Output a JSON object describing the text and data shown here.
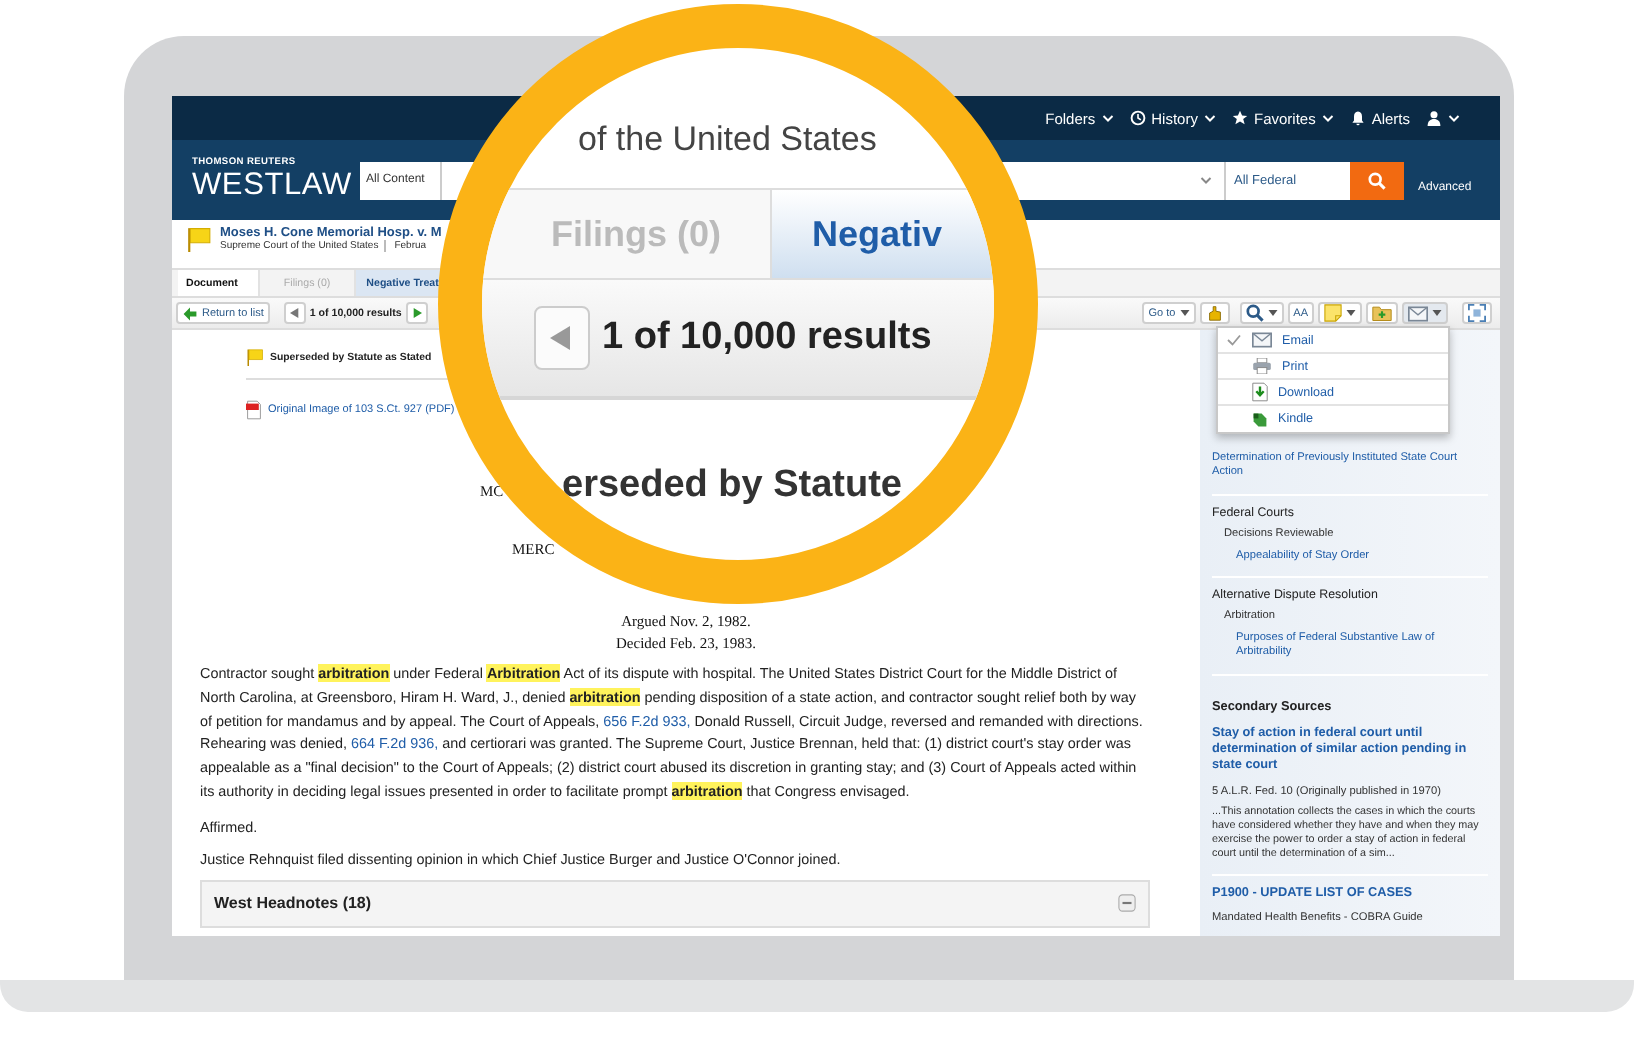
{
  "top_nav": {
    "items": [
      {
        "kind": "folders",
        "label": "Folders"
      },
      {
        "kind": "history",
        "label": "History"
      },
      {
        "kind": "favorites",
        "label": "Favorites"
      },
      {
        "kind": "alerts",
        "label": "Alerts"
      },
      {
        "kind": "account"
      }
    ]
  },
  "header": {
    "brand_small": "THOMSON REUTERS",
    "brand": "WESTLAW",
    "scope": "All Content",
    "jurisdiction": "All Federal",
    "advanced": "Advanced"
  },
  "document": {
    "title": "Moses H. Cone Memorial Hosp. v. M",
    "court": "Supreme Court of the United States",
    "date": "Februa"
  },
  "tabs": [
    {
      "label": "Document",
      "selected": true,
      "disabled": false,
      "highlighted": false
    },
    {
      "label": "Filings (0)",
      "selected": false,
      "disabled": true,
      "highlighted": false
    },
    {
      "label": "Negative Treat",
      "selected": false,
      "disabled": false,
      "highlighted": true
    }
  ],
  "toolbar": {
    "return": "Return to list",
    "results": "1 of 10,000 results",
    "goto": "Go to",
    "text_size": "AA"
  },
  "menu": {
    "items": [
      {
        "kind": "email",
        "label": "Email",
        "checked": true
      },
      {
        "kind": "print",
        "label": "Print",
        "checked": false
      },
      {
        "kind": "download",
        "label": "Download",
        "checked": false
      },
      {
        "kind": "kindle",
        "label": "Kindle",
        "checked": false
      }
    ]
  },
  "content": {
    "status": "Superseded by Statute as Stated",
    "original_image": "Original Image of 103 S.Ct. 927 (PDF)",
    "caption": [
      "MC",
      "MERC"
    ],
    "dates": [
      "Argued Nov. 2, 1982.",
      "Decided Feb. 23, 1983."
    ],
    "synopsis": [
      {
        "kind": "text",
        "text": "Contractor sought **arbitration** under Federal **Arbitration** Act of its dispute with hospital. The United States District Court for the Middle District of North Carolina, at Greensboro, Hiram H. Ward, J., denied **arbitration** pending disposition of a state action, and contractor sought relief both by way of petition for mandamus and by appeal. The Court of Appeals, "
      },
      {
        "kind": "link",
        "text": "656 F.2d 933,"
      },
      {
        "kind": "text",
        "text": " Donald Russell, Circuit Judge, reversed and remanded with directions. Rehearing was denied, "
      },
      {
        "kind": "link",
        "text": "664 F.2d 936,"
      },
      {
        "kind": "text",
        "text": " and certiorari was granted. The Supreme Court, Justice Brennan, held that: (1) district court's stay order was appealable as a \"final decision\" to the Court of Appeals; (2) district court abused its discretion in granting stay; and (3) Court of Appeals acted within its authority in deciding legal issues presented in order to facilitate prompt **arbitration** that Congress envisaged."
      }
    ],
    "paragraphs": [
      "Affirmed.",
      "Justice Rehnquist filed dissenting opinion in which Chief Justice Burger and Justice O'Connor joined."
    ],
    "headnotes": "West Headnotes (18)"
  },
  "sidebar": {
    "topics": [
      {
        "label": "Determination of Previously Instituted State Court Action"
      },
      {
        "label": "Federal Courts",
        "children": [
          {
            "label": "Decisions Reviewable",
            "children": [
              {
                "label": "Appealability of Stay Order"
              }
            ]
          }
        ]
      },
      {
        "label": "Alternative Dispute Resolution",
        "children": [
          {
            "label": "Arbitration",
            "children": [
              {
                "label": "Purposes of Federal Substantive Law of Arbitrability"
              }
            ]
          }
        ]
      }
    ],
    "secondary_title": "Secondary Sources",
    "sources": [
      {
        "title": "Stay of action in federal court until determination of similar action pending in state court",
        "citation": "5 A.L.R. Fed. 10 (Originally published in 1970)",
        "snippet": "...This annotation collects the cases in which the courts have considered whether they have and when they may exercise the power to order a stay of action in federal court until the determination of a sim..."
      },
      {
        "title": "P1900 - UPDATE LIST OF CASES",
        "citation": "Mandated Health Benefits - COBRA Guide"
      }
    ]
  },
  "magnifier": {
    "court": "of the United States",
    "tabs": [
      {
        "label": "Filings (0)",
        "disabled": true,
        "highlighted": false
      },
      {
        "label": "Negativ",
        "disabled": false,
        "highlighted": true
      }
    ],
    "results": "1 of 10,000 results",
    "status": "erseded by Statute"
  }
}
